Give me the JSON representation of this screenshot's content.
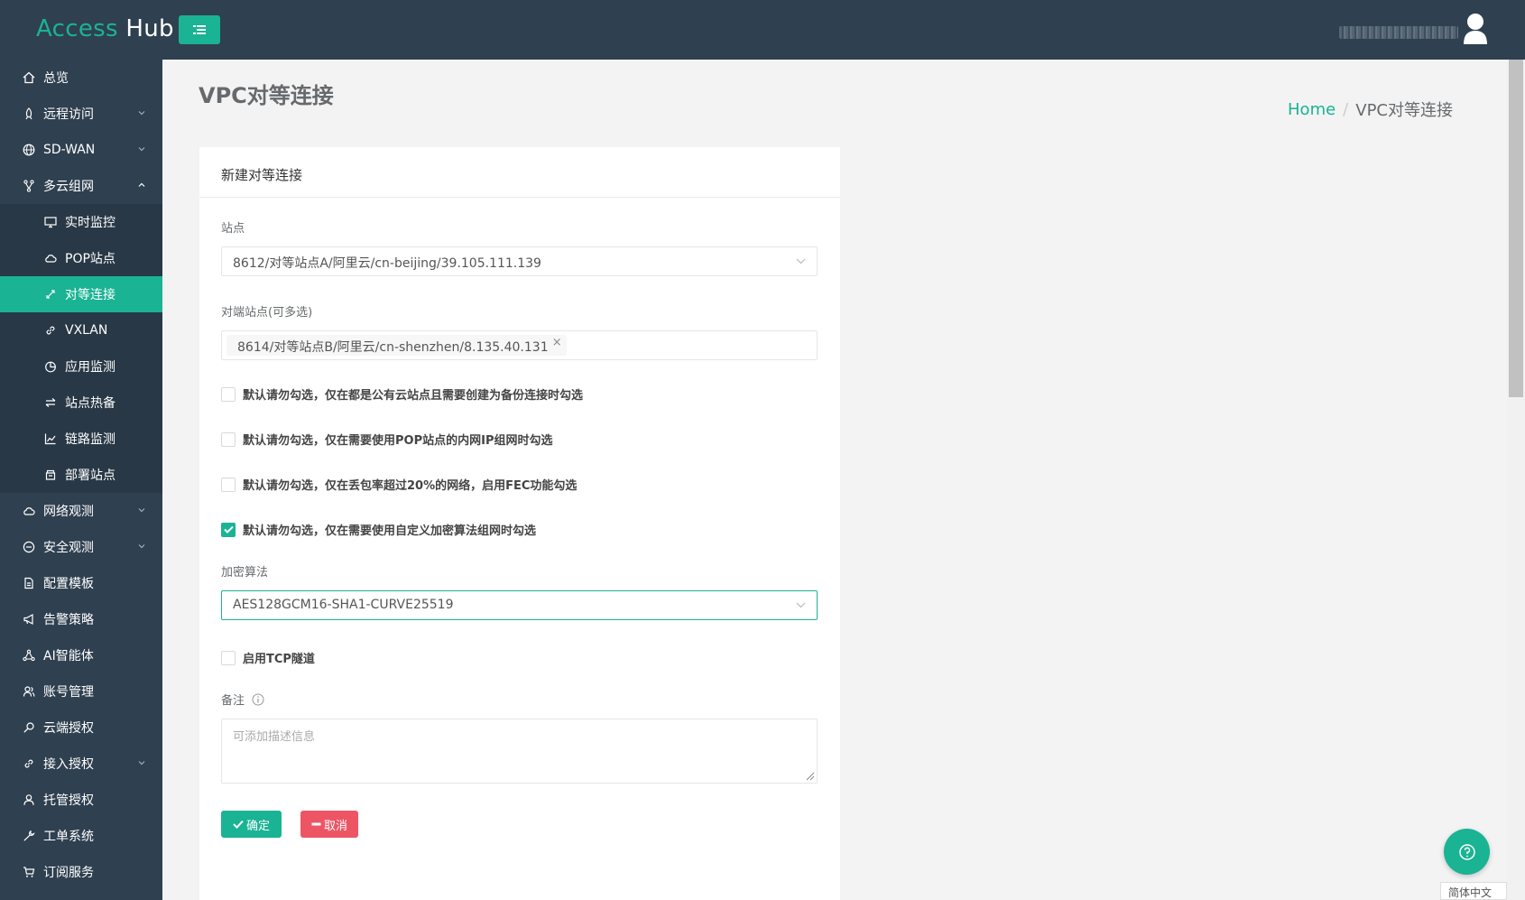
{
  "app": {
    "brand_part1": "Access",
    "brand_part2": "Hub",
    "user_name_redacted": ""
  },
  "sidebar": {
    "items": [
      {
        "label": "总览",
        "icon": "home-icon"
      },
      {
        "label": "远程访问",
        "icon": "rocket-icon"
      },
      {
        "label": "SD-WAN",
        "icon": "globe-icon"
      },
      {
        "label": "多云组网",
        "icon": "branch-icon"
      },
      {
        "label": "实时监控",
        "icon": "monitor-icon"
      },
      {
        "label": "POP站点",
        "icon": "cloud-icon"
      },
      {
        "label": "对等连接",
        "icon": "link-arrows-icon"
      },
      {
        "label": "VXLAN",
        "icon": "link-icon"
      },
      {
        "label": "应用监测",
        "icon": "pie-chart-icon"
      },
      {
        "label": "站点热备",
        "icon": "swap-icon"
      },
      {
        "label": "链路监测",
        "icon": "line-chart-icon"
      },
      {
        "label": "部署站点",
        "icon": "box-icon"
      },
      {
        "label": "网络观测",
        "icon": "cloud-icon"
      },
      {
        "label": "安全观测",
        "icon": "minus-circle-icon"
      },
      {
        "label": "配置模板",
        "icon": "file-icon"
      },
      {
        "label": "告警策略",
        "icon": "megaphone-icon"
      },
      {
        "label": "AI智能体",
        "icon": "network-icon"
      },
      {
        "label": "账号管理",
        "icon": "users-icon"
      },
      {
        "label": "云端授权",
        "icon": "key-icon"
      },
      {
        "label": "接入授权",
        "icon": "chain-icon"
      },
      {
        "label": "托管授权",
        "icon": "user-icon"
      },
      {
        "label": "工单系统",
        "icon": "wrench-icon"
      },
      {
        "label": "订阅服务",
        "icon": "cart-icon"
      }
    ]
  },
  "page": {
    "title": "VPC对等连接",
    "breadcrumb_home": "Home",
    "breadcrumb_sep": "/",
    "breadcrumb_current": "VPC对等连接"
  },
  "form": {
    "card_title": "新建对等连接",
    "site_label": "站点",
    "site_value": "8612/对等站点A/阿里云/cn-beijing/39.105.111.139",
    "peer_label": "对端站点(可多选)",
    "peer_tag": "8614/对等站点B/阿里云/cn-shenzhen/8.135.40.131",
    "peer_tag_close": "×",
    "checkboxes": [
      {
        "label": "默认请勿勾选，仅在都是公有云站点且需要创建为备份连接时勾选",
        "checked": false
      },
      {
        "label": "默认请勿勾选，仅在需要使用POP站点的内网IP组网时勾选",
        "checked": false
      },
      {
        "label": "默认请勿勾选，仅在丢包率超过20%的网络，启用FEC功能勾选",
        "checked": false
      },
      {
        "label": "默认请勿勾选，仅在需要使用自定义加密算法组网时勾选",
        "checked": true
      }
    ],
    "cipher_label": "加密算法",
    "cipher_value": "AES128GCM16-SHA1-CURVE25519",
    "tcp_label": "启用TCP隧道",
    "tcp_checked": false,
    "remark_label": "备注",
    "remark_placeholder": "可添加描述信息",
    "ok_label": "确定",
    "cancel_label": "取消"
  },
  "footer": {
    "language": "简体中文"
  },
  "colors": {
    "accent": "#1ab394",
    "sidebar_bg": "#2f4050",
    "danger": "#ed5565"
  }
}
